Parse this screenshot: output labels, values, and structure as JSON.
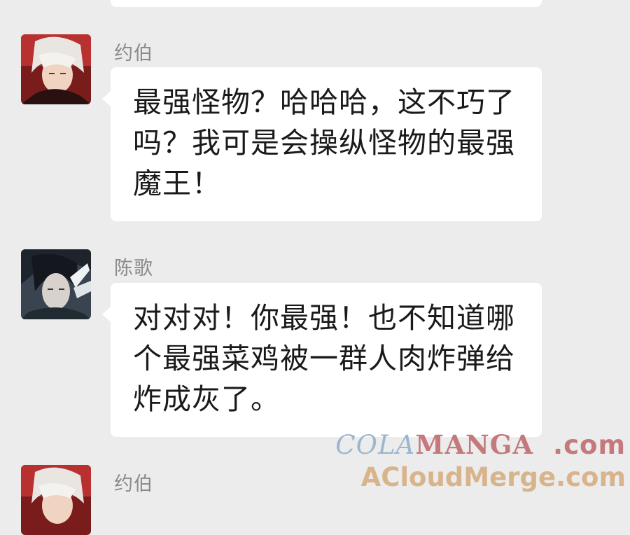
{
  "messages": [
    {
      "sender": "约伯",
      "avatar": "red-haired-character-avatar",
      "lines": [
        "最强怪物？哈哈哈，这不巧了",
        "吗？我可是会操纵怪物的最强",
        "魔王！"
      ]
    },
    {
      "sender": "陈歌",
      "avatar": "dark-haired-character-avatar",
      "lines": [
        "对对对！你最强！也不知道哪",
        "个最强菜鸡被一群人肉炸弹给",
        "炸成灰了。"
      ]
    },
    {
      "sender": "约伯",
      "avatar": "red-haired-character-avatar",
      "lines": []
    }
  ],
  "watermark": {
    "line1_a": "COLA",
    "line1_b": "MANGA",
    "line1_c": ".com",
    "line2": "ACloudMerge.com"
  },
  "colors": {
    "background": "#ececec",
    "bubble": "#ffffff",
    "name": "#8a8a8a",
    "text": "#1a1a1a"
  }
}
